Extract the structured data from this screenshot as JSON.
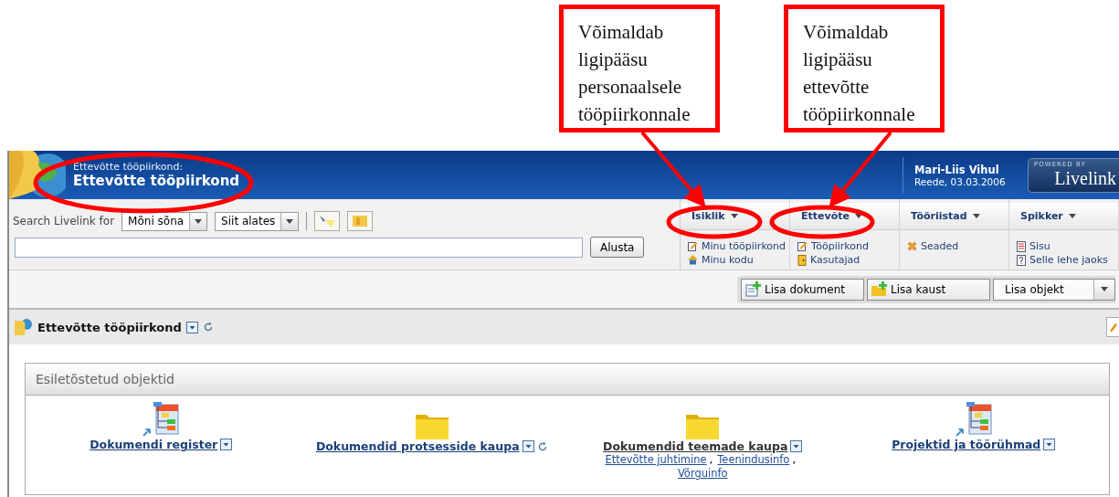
{
  "callouts": [
    {
      "text": "Võimaldab ligipääsu personaalsele tööpiirkonnale"
    },
    {
      "text": "Võimaldab ligipääsu ettevõtte tööpiirkonnale"
    }
  ],
  "header": {
    "subtitle": "Ettevõtte tööpiirkond:",
    "title": "Ettevõtte tööpiirkond",
    "user_name": "Mari-Liis Vihul",
    "date": "Reede, 03.03.2006",
    "logo_top": "POWERED BY",
    "logo_brand": "Livelink"
  },
  "search": {
    "label": "Search Livelink for",
    "mode": "Mõni sõna",
    "scope": "Siit alates",
    "button": "Alusta"
  },
  "menus": [
    {
      "label": "Isiklik",
      "items": [
        "Minu tööpiirkond",
        "Minu kodu"
      ]
    },
    {
      "label": "Ettevõte",
      "items": [
        "Tööpiirkond",
        "Kasutajad"
      ]
    },
    {
      "label": "Tööriistad",
      "items": [
        "Seaded"
      ]
    },
    {
      "label": "Spikker",
      "items": [
        "Sisu",
        "Selle lehe jaoks"
      ]
    }
  ],
  "actions": [
    "Lisa dokument",
    "Lisa kaust"
  ],
  "add_select": "Lisa objekt",
  "workspace": {
    "title": "Ettevõtte tööpiirkond"
  },
  "featured": {
    "title": "Esiletõstetud objektid",
    "link_separator": ",",
    "items": [
      {
        "kind": "register",
        "label": "Dokumendi register",
        "refresh": false,
        "visited": false
      },
      {
        "kind": "folder",
        "label": "Dokumendid protsesside kaupa",
        "refresh": true,
        "visited": false
      },
      {
        "kind": "folder",
        "label": "Dokumendid teemade kaupa",
        "refresh": false,
        "visited": true,
        "links": [
          "Ettevõtte juhtimine",
          "Teenindusinfo",
          "Võrguinfo"
        ]
      },
      {
        "kind": "register",
        "label": "Projektid ja töörühmad",
        "refresh": false,
        "visited": false
      }
    ]
  }
}
